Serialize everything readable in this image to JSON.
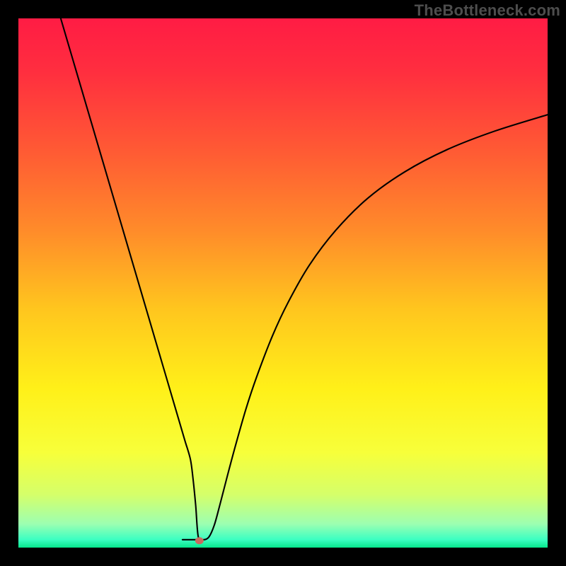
{
  "watermark": "TheBottleneck.com",
  "chart_data": {
    "type": "line",
    "title": "",
    "xlabel": "",
    "ylabel": "",
    "xlim": [
      0,
      100
    ],
    "ylim": [
      0,
      100
    ],
    "grid": false,
    "legend": false,
    "background_gradient": {
      "stops": [
        {
          "offset": 0.0,
          "color": "#ff1c44"
        },
        {
          "offset": 0.1,
          "color": "#ff2e3f"
        },
        {
          "offset": 0.25,
          "color": "#ff5a34"
        },
        {
          "offset": 0.4,
          "color": "#ff8b2a"
        },
        {
          "offset": 0.55,
          "color": "#ffc61e"
        },
        {
          "offset": 0.7,
          "color": "#fff019"
        },
        {
          "offset": 0.82,
          "color": "#f7ff3a"
        },
        {
          "offset": 0.9,
          "color": "#d5ff6a"
        },
        {
          "offset": 0.955,
          "color": "#9dffb1"
        },
        {
          "offset": 0.985,
          "color": "#3bffc2"
        },
        {
          "offset": 1.0,
          "color": "#07e68c"
        }
      ]
    },
    "series": [
      {
        "name": "curve",
        "color": "#000000",
        "width": 2.1,
        "x": [
          8.0,
          10,
          12,
          14,
          16,
          18,
          20,
          22,
          24,
          26,
          28,
          29.5,
          30.5,
          31.5,
          32.5,
          33.0,
          33.5,
          34.0,
          35.0,
          36.0,
          37.0,
          38.0,
          39.5,
          41.0,
          43.0,
          45.0,
          48.0,
          51.0,
          55.0,
          60.0,
          66.0,
          73.0,
          81.0,
          90.0,
          100.0
        ],
        "values": [
          100,
          93.2,
          86.4,
          79.6,
          72.8,
          66.0,
          59.2,
          52.4,
          45.6,
          38.8,
          32.0,
          26.9,
          23.5,
          20.1,
          16.7,
          13.0,
          8.0,
          2.0,
          1.5,
          2.0,
          4.2,
          7.8,
          13.6,
          19.2,
          26.2,
          32.2,
          40.0,
          46.4,
          53.4,
          60.0,
          66.0,
          71.0,
          75.2,
          78.7,
          81.8
        ]
      }
    ],
    "plateau": {
      "comment": "flat segment at bottom of V",
      "x": [
        31.0,
        34.0
      ],
      "y": 1.5
    },
    "marker": {
      "name": "minimum-dot",
      "x": 34.2,
      "y": 1.3,
      "rx": 6,
      "ry": 5,
      "fill": "#c96a5f"
    }
  }
}
